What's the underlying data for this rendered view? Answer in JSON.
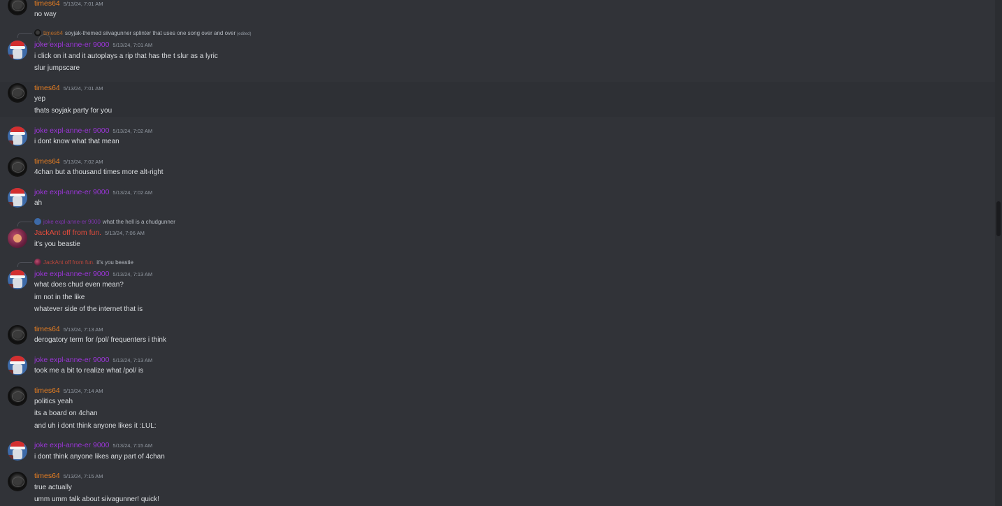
{
  "colors": {
    "background": "#313338",
    "name_times64": "#e67e22",
    "name_joke": "#9b35d8",
    "name_jackant": "#e74c3c",
    "text": "#dbdee1",
    "timestamp": "#949ba4"
  },
  "messages": [
    {
      "author": "times64",
      "time": "5/13/24, 7:01 AM",
      "lines": [
        "no way"
      ]
    },
    {
      "reply": {
        "author": "times64",
        "text": "soyjak-themed siivagunner splinter that uses one song over and over",
        "edited": "(edited)"
      },
      "author": "joke expl-anne-er 9000",
      "time": "5/13/24, 7:01 AM",
      "lines": [
        "i click on it and it autoplays a rip that has the t slur as a lyric",
        "slur jumpscare"
      ]
    },
    {
      "author": "times64",
      "time": "5/13/24, 7:01 AM",
      "lines": [
        "yep",
        "thats soyjak party for you"
      ]
    },
    {
      "author": "joke expl-anne-er 9000",
      "time": "5/13/24, 7:02 AM",
      "lines": [
        "i dont know what that mean"
      ]
    },
    {
      "author": "times64",
      "time": "5/13/24, 7:02 AM",
      "lines": [
        "4chan but a thousand times more alt-right"
      ]
    },
    {
      "author": "joke expl-anne-er 9000",
      "time": "5/13/24, 7:02 AM",
      "lines": [
        "ah"
      ]
    },
    {
      "reply": {
        "author": "joke expl-anne-er 9000",
        "text": "what the hell is a chudgunner"
      },
      "author": "JackAnt off from fun.",
      "time": "5/13/24, 7:06 AM",
      "lines": [
        "it's you beastie"
      ]
    },
    {
      "reply": {
        "author": "JackAnt off from fun.",
        "text": "it's you beastie"
      },
      "author": "joke expl-anne-er 9000",
      "time": "5/13/24, 7:13 AM",
      "lines": [
        "what does chud even mean?",
        "im not in the like",
        "whatever side of the internet that is"
      ]
    },
    {
      "author": "times64",
      "time": "5/13/24, 7:13 AM",
      "lines": [
        "derogatory term for /pol/ frequenters i think"
      ]
    },
    {
      "author": "joke expl-anne-er 9000",
      "time": "5/13/24, 7:13 AM",
      "lines": [
        "took me a bit to realize what /pol/ is"
      ]
    },
    {
      "author": "times64",
      "time": "5/13/24, 7:14 AM",
      "lines": [
        "politics yeah",
        "its a board on 4chan",
        "and uh i dont think anyone likes it :LUL:"
      ]
    },
    {
      "author": "joke expl-anne-er 9000",
      "time": "5/13/24, 7:15 AM",
      "lines": [
        "i dont think anyone likes any part of 4chan"
      ]
    },
    {
      "author": "times64",
      "time": "5/13/24, 7:15 AM",
      "lines": [
        "true actually",
        "umm umm talk about siivagunner! quick!"
      ]
    }
  ]
}
